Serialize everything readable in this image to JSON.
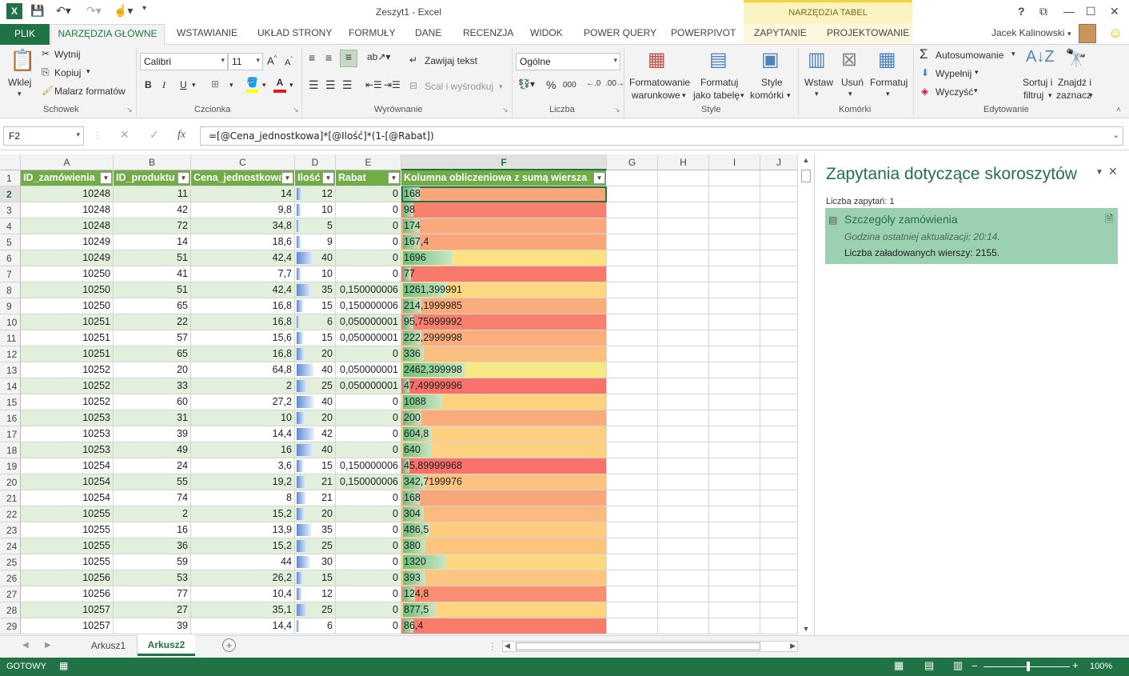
{
  "window": {
    "title": "Zeszyt1 - Excel",
    "context_title": "NARZĘDZIA TABEL",
    "help": "?"
  },
  "tabs": [
    "PLIK",
    "NARZĘDZIA GŁÓWNE",
    "WSTAWIANIE",
    "UKŁAD STRONY",
    "FORMUŁY",
    "DANE",
    "RECENZJA",
    "WIDOK",
    "POWER QUERY",
    "POWERPIVOT",
    "ZAPYTANIE",
    "PROJEKTOWANIE"
  ],
  "user": {
    "name": "Jacek Kalinowski"
  },
  "ribbon": {
    "clipboard": {
      "paste": "Wklej",
      "cut": "Wytnij",
      "copy": "Kopiuj",
      "painter": "Malarz formatów",
      "label": "Schowek"
    },
    "font": {
      "name": "Calibri",
      "size": "11",
      "label": "Czcionka"
    },
    "alignment": {
      "wrap": "Zawijaj tekst",
      "merge": "Scal i wyśrodkuj",
      "label": "Wyrównanie"
    },
    "number": {
      "format": "Ogólne",
      "percent": "%",
      "thousands": "000",
      "label": "Liczba"
    },
    "styles": {
      "conditional": [
        "Formatowanie",
        "warunkowe"
      ],
      "table": [
        "Formatuj",
        "jako tabelę"
      ],
      "cell": [
        "Style",
        "komórki"
      ],
      "label": "Style"
    },
    "cells": {
      "insert": "Wstaw",
      "delete": "Usuń",
      "format": "Formatuj",
      "label": "Komórki"
    },
    "editing": {
      "autosum": "Autosumowanie",
      "fill": "Wypełnij",
      "clear": "Wyczyść",
      "sort": [
        "Sortuj i",
        "filtruj"
      ],
      "find": [
        "Znajdź i",
        "zaznacz"
      ],
      "label": "Edytowanie"
    }
  },
  "formula_bar": {
    "name_box": "F2",
    "fx": "fx",
    "formula": "=[@Cena_jednostkowa]*[@Ilość]*(1-[@Rabat])"
  },
  "columns": [
    "A",
    "B",
    "C",
    "D",
    "E",
    "F",
    "G",
    "H",
    "I",
    "J"
  ],
  "table_headers": [
    "ID_zamówienia",
    "ID_produktu",
    "Cena_jednostkowa",
    "Ilość",
    "Rabat",
    "Kolumna obliczeniowa z sumą wiersza"
  ],
  "rows": [
    {
      "r": "2",
      "a": "10248",
      "b": "11",
      "c": "14",
      "d": "12",
      "e": "0",
      "f": "168",
      "color": "#f9a77a",
      "bar": 0.08
    },
    {
      "r": "3",
      "a": "10248",
      "b": "42",
      "c": "9,8",
      "d": "10",
      "e": "0",
      "f": "98",
      "color": "#f8806e",
      "bar": 0.05
    },
    {
      "r": "4",
      "a": "10248",
      "b": "72",
      "c": "34,8",
      "d": "5",
      "e": "0",
      "f": "174",
      "color": "#f9a97b",
      "bar": 0.08
    },
    {
      "r": "5",
      "a": "10249",
      "b": "14",
      "c": "18,6",
      "d": "9",
      "e": "0",
      "f": "167,4",
      "color": "#f9a77a",
      "bar": 0.08
    },
    {
      "r": "6",
      "a": "10249",
      "b": "51",
      "c": "42,4",
      "d": "40",
      "e": "0",
      "f": "1696",
      "color": "#fde283",
      "bar": 0.24
    },
    {
      "r": "7",
      "a": "10250",
      "b": "41",
      "c": "7,7",
      "d": "10",
      "e": "0",
      "f": "77",
      "color": "#f8786b",
      "bar": 0.04
    },
    {
      "r": "8",
      "a": "10250",
      "b": "51",
      "c": "42,4",
      "d": "35",
      "e": "0,150000006",
      "f": "1261,399991",
      "color": "#fed880",
      "bar": 0.21
    },
    {
      "r": "9",
      "a": "10250",
      "b": "65",
      "c": "16,8",
      "d": "15",
      "e": "0,150000006",
      "f": "214,1999985",
      "color": "#faad7c",
      "bar": 0.09
    },
    {
      "r": "10",
      "a": "10251",
      "b": "22",
      "c": "16,8",
      "d": "6",
      "e": "0,050000001",
      "f": "95,75999992",
      "color": "#f8806e",
      "bar": 0.05
    },
    {
      "r": "11",
      "a": "10251",
      "b": "57",
      "c": "15,6",
      "d": "15",
      "e": "0,050000001",
      "f": "222,2999998",
      "color": "#faae7c",
      "bar": 0.09
    },
    {
      "r": "12",
      "a": "10251",
      "b": "65",
      "c": "16,8",
      "d": "20",
      "e": "0",
      "f": "336",
      "color": "#fbc07f",
      "bar": 0.1
    },
    {
      "r": "13",
      "a": "10252",
      "b": "20",
      "c": "64,8",
      "d": "40",
      "e": "0,050000001",
      "f": "2462,399998",
      "color": "#f6e984",
      "bar": 0.3
    },
    {
      "r": "14",
      "a": "10252",
      "b": "33",
      "c": "2",
      "d": "25",
      "e": "0,050000001",
      "f": "47,49999996",
      "color": "#f8716a",
      "bar": 0.03
    },
    {
      "r": "15",
      "a": "10252",
      "b": "60",
      "c": "27,2",
      "d": "40",
      "e": "0",
      "f": "1088",
      "color": "#fed37f",
      "bar": 0.19
    },
    {
      "r": "16",
      "a": "10253",
      "b": "31",
      "c": "10",
      "d": "20",
      "e": "0",
      "f": "200",
      "color": "#faab7b",
      "bar": 0.09
    },
    {
      "r": "17",
      "a": "10253",
      "b": "39",
      "c": "14,4",
      "d": "42",
      "e": "0",
      "f": "604,8",
      "color": "#fdd07f",
      "bar": 0.14
    },
    {
      "r": "18",
      "a": "10253",
      "b": "49",
      "c": "16",
      "d": "40",
      "e": "0",
      "f": "640",
      "color": "#fdd17f",
      "bar": 0.14
    },
    {
      "r": "19",
      "a": "10254",
      "b": "24",
      "c": "3,6",
      "d": "15",
      "e": "0,150000006",
      "f": "45,89999968",
      "color": "#f8716a",
      "bar": 0.03
    },
    {
      "r": "20",
      "a": "10254",
      "b": "55",
      "c": "19,2",
      "d": "21",
      "e": "0,150000006",
      "f": "342,7199976",
      "color": "#fcc280",
      "bar": 0.11
    },
    {
      "r": "21",
      "a": "10254",
      "b": "74",
      "c": "8",
      "d": "21",
      "e": "0",
      "f": "168",
      "color": "#f9a77a",
      "bar": 0.08
    },
    {
      "r": "22",
      "a": "10255",
      "b": "2",
      "c": "15,2",
      "d": "20",
      "e": "0",
      "f": "304",
      "color": "#fbbb7e",
      "bar": 0.1
    },
    {
      "r": "23",
      "a": "10255",
      "b": "16",
      "c": "13,9",
      "d": "35",
      "e": "0",
      "f": "486,5",
      "color": "#fdcc7f",
      "bar": 0.13
    },
    {
      "r": "24",
      "a": "10255",
      "b": "36",
      "c": "15,2",
      "d": "25",
      "e": "0",
      "f": "380",
      "color": "#fcc57f",
      "bar": 0.11
    },
    {
      "r": "25",
      "a": "10255",
      "b": "59",
      "c": "44",
      "d": "30",
      "e": "0",
      "f": "1320",
      "color": "#fed880",
      "bar": 0.21
    },
    {
      "r": "26",
      "a": "10256",
      "b": "53",
      "c": "26,2",
      "d": "15",
      "e": "0",
      "f": "393",
      "color": "#fcc680",
      "bar": 0.11
    },
    {
      "r": "27",
      "a": "10256",
      "b": "77",
      "c": "10,4",
      "d": "12",
      "e": "0",
      "f": "124,8",
      "color": "#f98e72",
      "bar": 0.06
    },
    {
      "r": "28",
      "a": "10257",
      "b": "27",
      "c": "35,1",
      "d": "25",
      "e": "0",
      "f": "877,5",
      "color": "#fdd47f",
      "bar": 0.16
    },
    {
      "r": "29",
      "a": "10257",
      "b": "39",
      "c": "14,4",
      "d": "6",
      "e": "0",
      "f": "86,4",
      "color": "#f87b6c",
      "bar": 0.05
    }
  ],
  "panel": {
    "title": "Zapytania dotyczące skoroszytów",
    "count_label": "Liczba zapytań: 1",
    "query_name": "Szczegóły zamówienia",
    "updated": "Godzina ostatniej aktualizacji: 20:14.",
    "loaded": "Liczba załadowanych wierszy: 2155."
  },
  "sheets": [
    "Arkusz1",
    "Arkusz2"
  ],
  "active_sheet": "Arkusz2",
  "status": {
    "mode": "GOTOWY",
    "zoom": "100%"
  },
  "colors": {
    "accent": "#217346",
    "table_header": "#70ad47",
    "band": "#e2efda",
    "panel_card": "#9bd0b0"
  }
}
